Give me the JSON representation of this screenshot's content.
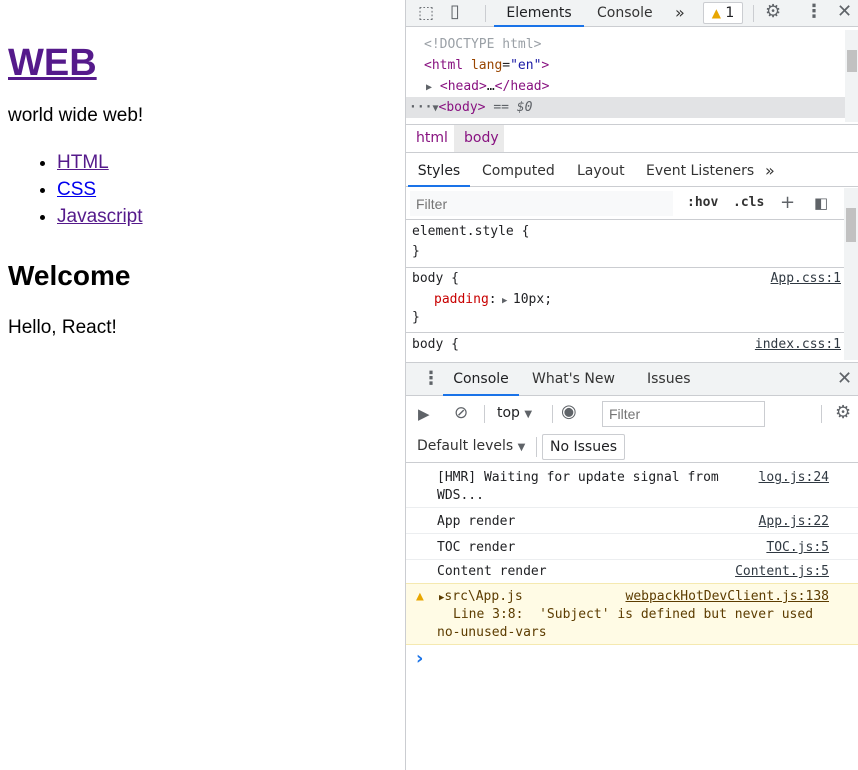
{
  "page": {
    "heading": "WEB",
    "intro": "world wide web!",
    "nav": [
      "HTML",
      "CSS",
      "Javascript"
    ],
    "subheading": "Welcome",
    "body": "Hello, React!"
  },
  "devtools": {
    "tabs": {
      "elements": "Elements",
      "console": "Console",
      "more": "»",
      "issues_count": "1"
    },
    "dom": {
      "doctype": "<!DOCTYPE html>",
      "html_tag": "html",
      "lang_attr": "lang",
      "lang_value": "\"en\"",
      "head_node": "head",
      "head_ellipsis": "…",
      "body_tag": "body",
      "body_suffix": "== $0"
    },
    "breadcrumbs": [
      "html",
      "body"
    ],
    "styles_tabs": [
      "Styles",
      "Computed",
      "Layout",
      "Event Listeners",
      "»"
    ],
    "styles_filter_placeholder": "Filter",
    "hov": ":hov",
    "cls": ".cls",
    "rules": [
      {
        "selector": "element.style {",
        "close": "}"
      },
      {
        "selector": "body {",
        "prop": "padding",
        "value": "10px;",
        "close": "}",
        "source": "App.css:1"
      },
      {
        "selector": "body {",
        "source": "index.css:1"
      }
    ],
    "drawer": {
      "tabs": [
        "Console",
        "What's New",
        "Issues"
      ],
      "context": "top",
      "filter_placeholder": "Filter",
      "levels": "Default levels",
      "no_issues": "No Issues",
      "messages": [
        {
          "text": "[HMR] Waiting for update signal from WDS...",
          "source": "log.js:24"
        },
        {
          "text": "App render",
          "source": "App.js:22"
        },
        {
          "text": "TOC render",
          "source": "TOC.js:5"
        },
        {
          "text": "Content render",
          "source": "Content.js:5"
        }
      ],
      "warning": {
        "file": "src\\App.js",
        "source": "webpackHotDevClient.js:138",
        "detail": "Line 3:8:  'Subject' is defined but never used",
        "rule": "no-unused-vars"
      },
      "prompt": "›"
    }
  },
  "colors": {
    "accent": "#1a73e8",
    "visited_link": "#551a8b",
    "link": "#0000ee",
    "warning_bg": "#fffbe5"
  }
}
